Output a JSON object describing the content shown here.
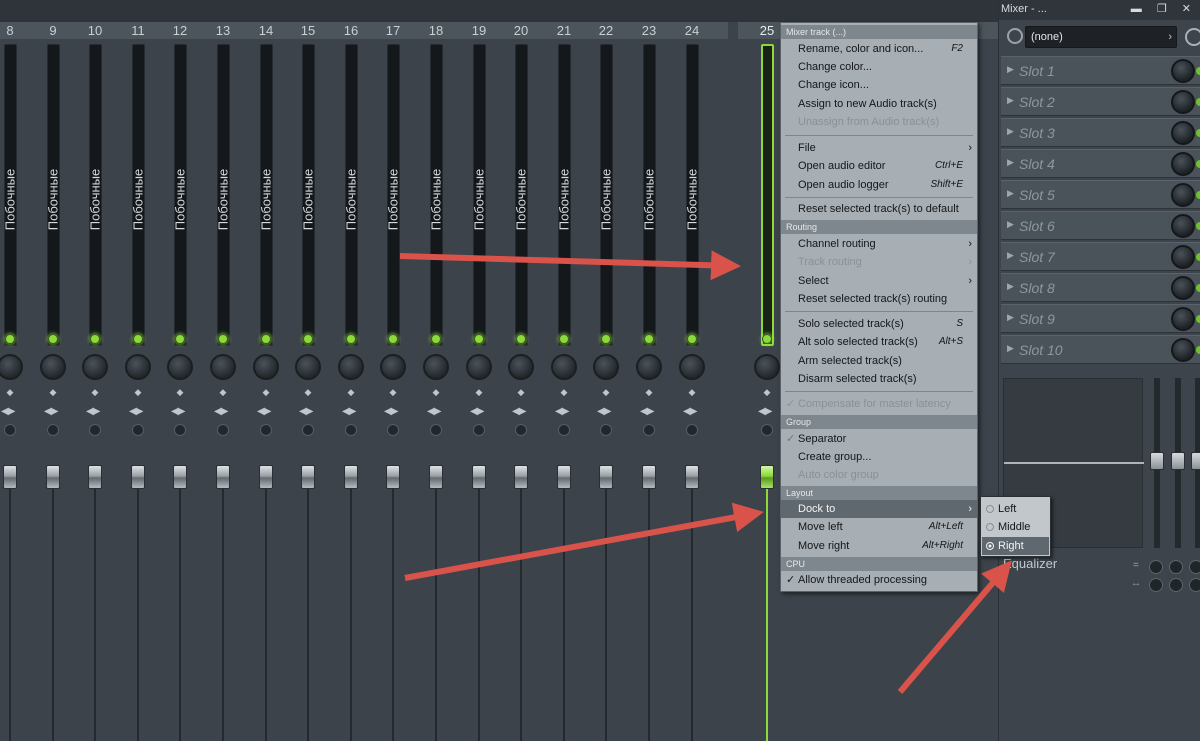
{
  "mixer": {
    "strip_numbers": [
      "8",
      "9",
      "10",
      "11",
      "12",
      "13",
      "14",
      "15",
      "16",
      "17",
      "18",
      "19",
      "20",
      "21",
      "22",
      "23",
      "24",
      "25"
    ],
    "strip_name": "Побочные",
    "selected_strip": "25"
  },
  "panel": {
    "title": "Mixer - ...",
    "window_buttons": "▬ ❐ ✕",
    "preset_value": "(none)",
    "slots": [
      "Slot 1",
      "Slot 2",
      "Slot 3",
      "Slot 4",
      "Slot 5",
      "Slot 6",
      "Slot 7",
      "Slot 8",
      "Slot 9",
      "Slot 10"
    ],
    "eq_label": "Equalizer"
  },
  "menu": {
    "header": "Mixer track (...)",
    "items": {
      "rename": {
        "label": "Rename, color and icon...",
        "shortcut": "F2"
      },
      "change_color": {
        "label": "Change color..."
      },
      "change_icon": {
        "label": "Change icon..."
      },
      "assign_audio": {
        "label": "Assign to new Audio track(s)"
      },
      "unassign_audio": {
        "label": "Unassign from Audio track(s)"
      },
      "file": {
        "label": "File"
      },
      "open_editor": {
        "label": "Open audio editor",
        "shortcut": "Ctrl+E"
      },
      "open_logger": {
        "label": "Open audio logger",
        "shortcut": "Shift+E"
      },
      "reset_default": {
        "label": "Reset selected track(s) to default"
      },
      "channel_routing": {
        "label": "Channel routing"
      },
      "track_routing": {
        "label": "Track routing"
      },
      "select": {
        "label": "Select"
      },
      "reset_routing": {
        "label": "Reset selected track(s) routing"
      },
      "solo": {
        "label": "Solo selected track(s)",
        "shortcut": "S"
      },
      "alt_solo": {
        "label": "Alt solo selected track(s)",
        "shortcut": "Alt+S"
      },
      "arm": {
        "label": "Arm selected track(s)"
      },
      "disarm": {
        "label": "Disarm selected track(s)"
      },
      "compensate": {
        "label": "Compensate for master latency"
      },
      "separator": {
        "label": "Separator"
      },
      "create_group": {
        "label": "Create group..."
      },
      "auto_color": {
        "label": "Auto color group"
      },
      "dock_to": {
        "label": "Dock to"
      },
      "move_left": {
        "label": "Move left",
        "shortcut": "Alt+Left"
      },
      "move_right": {
        "label": "Move right",
        "shortcut": "Alt+Right"
      },
      "threaded": {
        "label": "Allow threaded processing"
      }
    },
    "sections": {
      "routing": "Routing",
      "group": "Group",
      "layout": "Layout",
      "cpu": "CPU"
    }
  },
  "submenu": {
    "options": [
      "Left",
      "Middle",
      "Right"
    ],
    "selected": "Right"
  },
  "colors": {
    "accent_green": "#8bd93a",
    "annotation_red": "#d9534a"
  }
}
